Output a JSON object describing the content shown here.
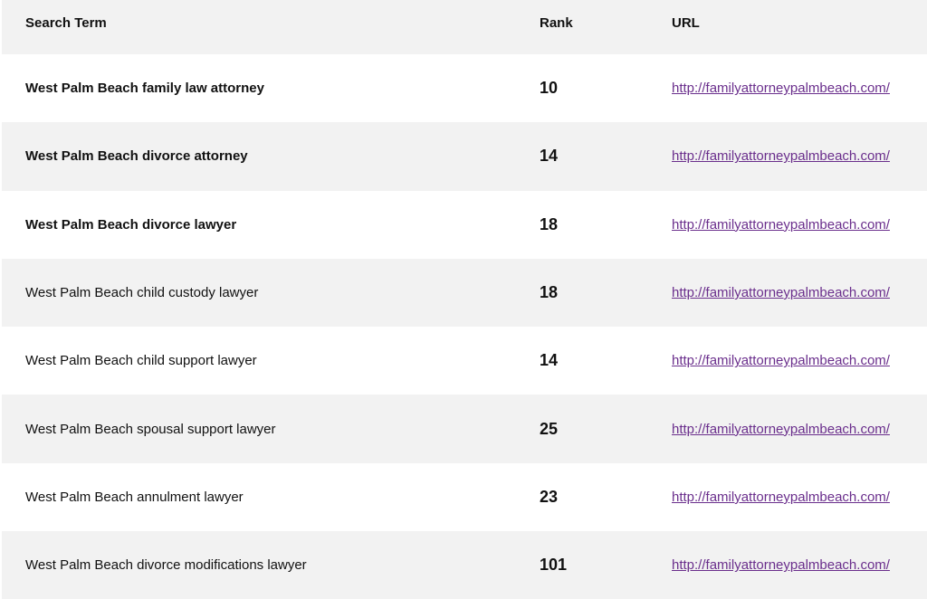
{
  "table": {
    "headers": {
      "term": "Search Term",
      "rank": "Rank",
      "url": "URL"
    },
    "rows": [
      {
        "term": "West Palm Beach family law attorney",
        "rank": "10",
        "url": "http://familyattorneypalmbeach.com/",
        "bold": true
      },
      {
        "term": "West Palm Beach divorce attorney",
        "rank": "14",
        "url": "http://familyattorneypalmbeach.com/",
        "bold": true
      },
      {
        "term": "West Palm Beach divorce lawyer",
        "rank": "18",
        "url": "http://familyattorneypalmbeach.com/",
        "bold": true
      },
      {
        "term": "West Palm Beach child custody lawyer",
        "rank": "18",
        "url": "http://familyattorneypalmbeach.com/",
        "bold": false
      },
      {
        "term": "West Palm Beach child support lawyer",
        "rank": "14",
        "url": "http://familyattorneypalmbeach.com/",
        "bold": false
      },
      {
        "term": "West Palm Beach spousal support lawyer",
        "rank": "25",
        "url": "http://familyattorneypalmbeach.com/",
        "bold": false
      },
      {
        "term": "West Palm Beach annulment lawyer",
        "rank": "23",
        "url": "http://familyattorneypalmbeach.com/",
        "bold": false
      },
      {
        "term": "West Palm Beach divorce modifications lawyer",
        "rank": "101",
        "url": "http://familyattorneypalmbeach.com/",
        "bold": false
      }
    ]
  },
  "colors": {
    "stripe": "#f2f2f2",
    "link": "#6a2e8c",
    "text": "#111111"
  }
}
